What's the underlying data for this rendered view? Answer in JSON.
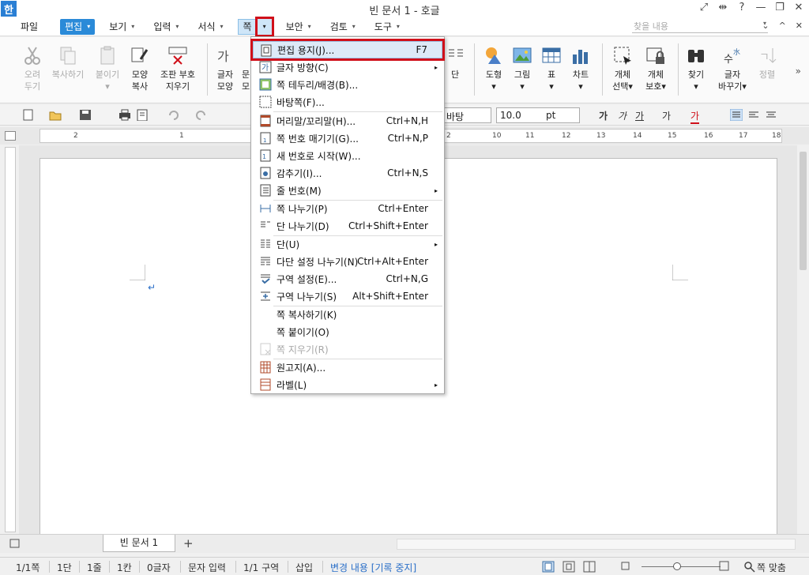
{
  "app": {
    "logo_char": "한",
    "title": "빈 문서 1 - 호글"
  },
  "window_controls": [
    "⤢",
    "⇹",
    "?",
    "—",
    "❐",
    "✕"
  ],
  "menubar": {
    "file": "파일",
    "items": [
      {
        "label": "편집",
        "arrow": "▾",
        "state": "active"
      },
      {
        "label": "보기",
        "arrow": "▾"
      },
      {
        "label": "입력",
        "arrow": "▾"
      },
      {
        "label": "서식",
        "arrow": "▾"
      },
      {
        "label": "쪽",
        "arrow": "",
        "state": "opened"
      },
      {
        "label": "보안",
        "arrow": "▾"
      },
      {
        "label": "검토",
        "arrow": "▾"
      },
      {
        "label": "도구",
        "arrow": "▾"
      }
    ],
    "dropdown_glyph": "▾",
    "search_placeholder": "찾을 내용",
    "right_icons": [
      "⌄",
      "^",
      "✕"
    ]
  },
  "ribbon": {
    "buttons_left": [
      {
        "label1": "오려",
        "label2": "두기",
        "icon": "scissors-icon",
        "disabled": true
      },
      {
        "label1": "복사하기",
        "label2": "",
        "icon": "copy-icon",
        "disabled": true
      },
      {
        "label1": "붙이기",
        "label2": "▾",
        "icon": "paste-icon",
        "disabled": true
      },
      {
        "label1": "모양",
        "label2": "복사",
        "icon": "format-painter-icon",
        "disabled": false
      },
      {
        "label1": "조판 부호",
        "label2": "지우기",
        "icon": "clear-codes-icon",
        "disabled": false
      },
      {
        "label1": "글자",
        "label2": "모양",
        "icon": "char-shape-icon",
        "disabled": false
      },
      {
        "label1": "문",
        "label2": "모",
        "icon": "para-icon",
        "disabled": false
      }
    ],
    "buttons_right": [
      {
        "label1": "단",
        "label2": "",
        "icon": "columns-icon"
      },
      {
        "label1": "도형",
        "label2": "▾",
        "icon": "shape-icon"
      },
      {
        "label1": "그림",
        "label2": "▾",
        "icon": "picture-icon"
      },
      {
        "label1": "표",
        "label2": "▾",
        "icon": "table-icon"
      },
      {
        "label1": "차트",
        "label2": "▾",
        "icon": "chart-icon"
      },
      {
        "label1": "개체",
        "label2": "선택▾",
        "icon": "select-object-icon"
      },
      {
        "label1": "개체",
        "label2": "보호▾",
        "icon": "protect-object-icon"
      },
      {
        "label1": "찾기",
        "label2": "▾",
        "icon": "binoculars-icon"
      },
      {
        "label1": "글자",
        "label2": "바꾸기▾",
        "icon": "replace-char-icon"
      },
      {
        "label1": "정렬",
        "label2": "",
        "icon": "sort-icon",
        "disabled": true
      }
    ],
    "more": "»"
  },
  "toolbar2": {
    "font": "바탕",
    "size": "10.0",
    "unit": "pt",
    "format_buttons": [
      "가",
      "가",
      "가",
      "가",
      "가"
    ]
  },
  "ruler": {
    "numbers": [
      "2",
      "1",
      "1",
      "2",
      "10",
      "11",
      "12",
      "13",
      "14",
      "15",
      "16",
      "17",
      "18"
    ]
  },
  "dropdown": {
    "items": [
      {
        "label": "편집 용지(J)...",
        "shortcut": "F7",
        "icon": "page-setup-icon",
        "highlight": true
      },
      {
        "label": "글자 방향(C)",
        "shortcut": "",
        "icon": "text-direction-icon",
        "sub": true
      },
      {
        "label": "쪽 테두리/배경(B)...",
        "shortcut": "",
        "icon": "page-border-icon"
      },
      {
        "label": "바탕쪽(F)...",
        "shortcut": "",
        "icon": "master-page-icon"
      },
      {
        "label": "머리말/꼬리말(H)...",
        "shortcut": "Ctrl+N,H",
        "icon": "header-footer-icon"
      },
      {
        "label": "쪽 번호 매기기(G)...",
        "shortcut": "Ctrl+N,P",
        "icon": "page-number-icon"
      },
      {
        "label": "새 번호로 시작(W)...",
        "shortcut": "",
        "icon": "new-number-icon"
      },
      {
        "label": "감추기(I)...",
        "shortcut": "Ctrl+N,S",
        "icon": "hide-icon"
      },
      {
        "label": "줄 번호(M)",
        "shortcut": "",
        "icon": "line-number-icon",
        "sub": true
      },
      {
        "label": "쪽 나누기(P)",
        "shortcut": "Ctrl+Enter",
        "icon": "page-break-icon"
      },
      {
        "label": "단 나누기(D)",
        "shortcut": "Ctrl+Shift+Enter",
        "icon": "column-break-icon"
      },
      {
        "label": "단(U)",
        "shortcut": "",
        "icon": "columns-menu-icon",
        "sub": true
      },
      {
        "label": "다단 설정 나누기(N)",
        "shortcut": "Ctrl+Alt+Enter",
        "icon": "multi-column-icon"
      },
      {
        "label": "구역 설정(E)...",
        "shortcut": "Ctrl+N,G",
        "icon": "section-setting-icon"
      },
      {
        "label": "구역 나누기(S)",
        "shortcut": "Alt+Shift+Enter",
        "icon": "section-break-icon"
      },
      {
        "label": "쪽 복사하기(K)",
        "shortcut": "",
        "icon": ""
      },
      {
        "label": "쪽 붙이기(O)",
        "shortcut": "",
        "icon": ""
      },
      {
        "label": "쪽 지우기(R)",
        "shortcut": "",
        "icon": "delete-page-icon",
        "disabled": true
      },
      {
        "label": "원고지(A)...",
        "shortcut": "",
        "icon": "manuscript-icon"
      },
      {
        "label": "라벨(L)",
        "shortcut": "",
        "icon": "label-icon",
        "sub": true
      }
    ],
    "sub_glyph": "▸"
  },
  "tabs": {
    "doc_tab": "빈 문서 1",
    "add": "+"
  },
  "statusbar": {
    "page": "1/1쪽",
    "column": "1단",
    "line": "1줄",
    "col": "1칸",
    "chars": "0글자",
    "mode": "문자 입력",
    "section": "1/1 구역",
    "insert": "삽입",
    "track": "변경 내용 [기록 중지]",
    "zoom_fit": "쪽 맞춤",
    "zoom_level": 0.45
  },
  "colors": {
    "accent": "#2a8ad8",
    "highlight_border": "#d0101a"
  }
}
